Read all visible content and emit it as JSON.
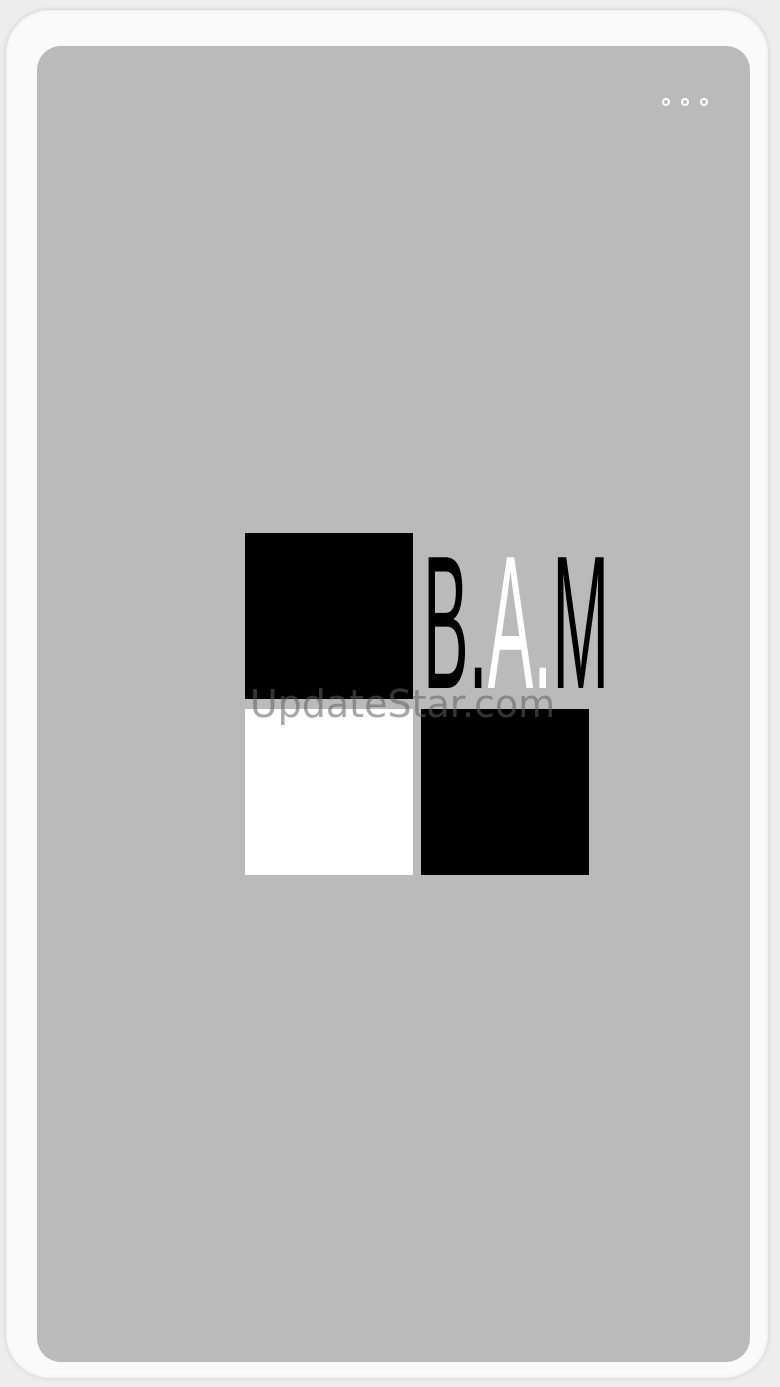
{
  "app": {
    "logo": {
      "part1": "B.",
      "part2": "A.",
      "part3": "M"
    },
    "menu_icon": "more-horizontal-icon",
    "watermark": "UpdateStar.com"
  },
  "colors": {
    "background": "#bababa",
    "frame": "#fafafa",
    "logo_dark": "#000000",
    "logo_light": "#ffffff"
  }
}
